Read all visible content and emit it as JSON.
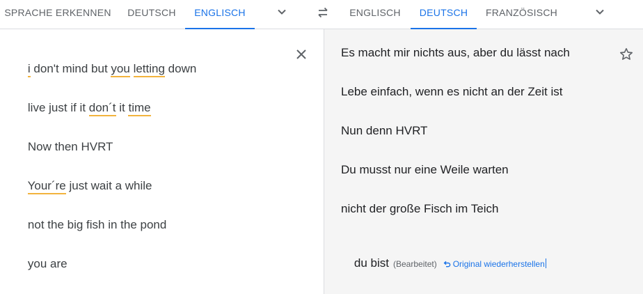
{
  "source_languages": {
    "detect": "SPRACHE ERKENNEN",
    "lang1": "DEUTSCH",
    "lang2": "ENGLISCH",
    "active": "ENGLISCH"
  },
  "target_languages": {
    "lang1": "ENGLISCH",
    "lang2": "DEUTSCH",
    "lang3": "FRANZÖSISCH",
    "active": "DEUTSCH"
  },
  "icons": {
    "more_source": "chevron-down-icon",
    "swap": "swap-icon",
    "more_target": "chevron-down-icon",
    "clear": "close-icon",
    "save": "star-icon",
    "restore": "undo-icon"
  },
  "colors": {
    "accent": "#1a73e8",
    "spell_underline": "#f2b33d",
    "target_background": "#f5f5f5"
  },
  "source_lines": [
    [
      "i",
      " don't mind but ",
      "you",
      " ",
      "letting",
      " down"
    ],
    [
      "live just if it ",
      "don´t",
      " it ",
      "time"
    ],
    [
      "Now then HVRT"
    ],
    [
      "Your´re",
      " just wait a while"
    ],
    [
      "not the big fish in the pond"
    ],
    [
      "you are"
    ]
  ],
  "target_lines": [
    "Es macht mir nichts aus, aber du lässt nach",
    "Lebe einfach, wenn es nicht an der Zeit ist",
    "Nun denn HVRT",
    "Du musst nur eine Weile warten",
    "nicht der große Fisch im Teich",
    "du bist"
  ],
  "edited_label": "(Bearbeitet)",
  "restore_label": "Original wiederherstellen"
}
